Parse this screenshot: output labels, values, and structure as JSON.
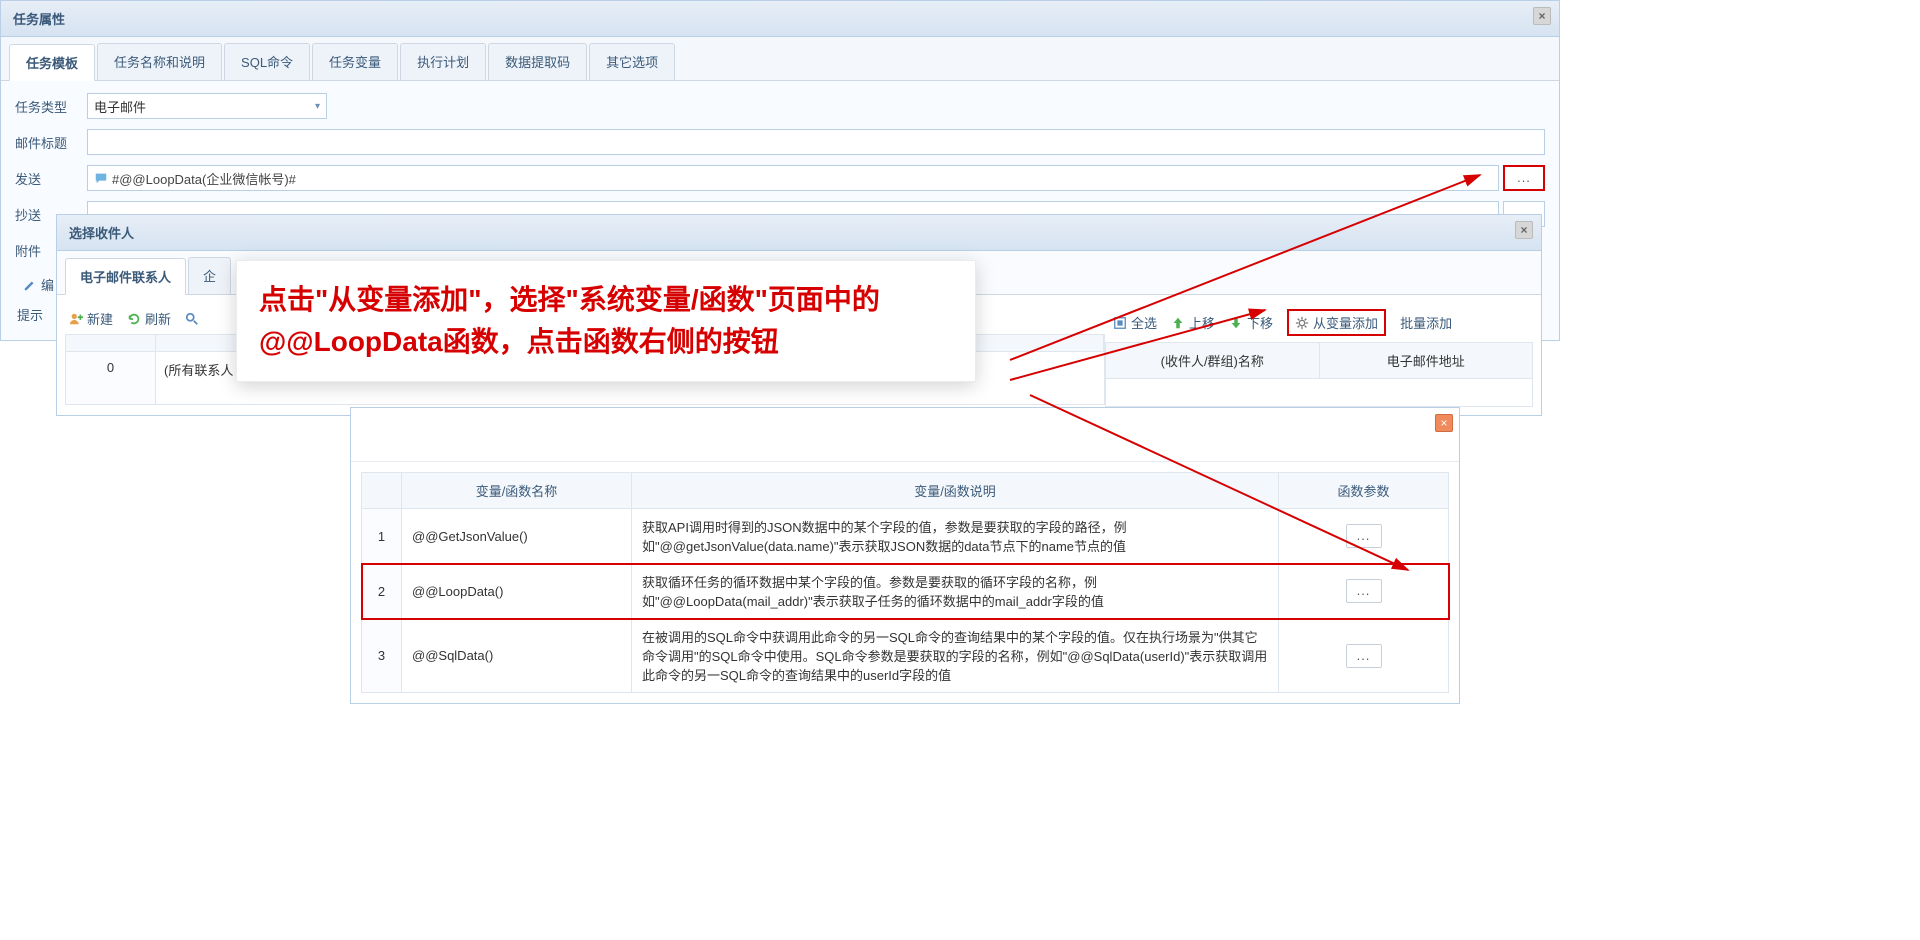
{
  "main_dialog": {
    "title": "任务属性",
    "tabs": [
      "任务模板",
      "任务名称和说明",
      "SQL命令",
      "任务变量",
      "执行计划",
      "数据提取码",
      "其它选项"
    ],
    "active_tab_index": 0,
    "form": {
      "task_type_label": "任务类型",
      "task_type_value": "电子邮件",
      "subject_label": "邮件标题",
      "subject_value": "",
      "send_label": "发送",
      "send_value": "#@@LoopData(企业微信帐号)#",
      "cc_label": "抄送",
      "attachment_label": "附件",
      "edit_label": "编",
      "tip_label": "提示"
    }
  },
  "picker_dialog": {
    "title": "选择收件人",
    "tabs": [
      "电子邮件联系人",
      "企"
    ],
    "active_tab_index": 0,
    "left_toolbar": {
      "new": "新建",
      "refresh": "刷新",
      "search": ""
    },
    "left_grid": {
      "idx": "0",
      "cell": "(所有联系人"
    },
    "right_toolbar": {
      "select_all": "全选",
      "move_up": "上移",
      "move_down": "下移",
      "from_var": "从变量添加",
      "batch_add": "批量添加"
    },
    "right_headers": {
      "name": "(收件人/群组)名称",
      "email": "电子邮件地址"
    }
  },
  "var_dialog": {
    "headers": {
      "name": "变量/函数名称",
      "desc": "变量/函数说明",
      "param": "函数参数"
    },
    "rows": [
      {
        "idx": "1",
        "name": "@@GetJsonValue()",
        "desc": "获取API调用时得到的JSON数据中的某个字段的值，参数是要获取的字段的路径，例如\"@@getJsonValue(data.name)\"表示获取JSON数据的data节点下的name节点的值",
        "param": "..."
      },
      {
        "idx": "2",
        "name": "@@LoopData()",
        "desc": "获取循环任务的循环数据中某个字段的值。参数是要获取的循环字段的名称，例如\"@@LoopData(mail_addr)\"表示获取子任务的循环数据中的mail_addr字段的值",
        "param": "..."
      },
      {
        "idx": "3",
        "name": "@@SqlData()",
        "desc": "在被调用的SQL命令中获调用此命令的另一SQL命令的查询结果中的某个字段的值。仅在执行场景为\"供其它命令调用\"的SQL命令中使用。SQL命令参数是要获取的字段的名称，例如\"@@SqlData(userId)\"表示获取调用此命令的另一SQL命令的查询结果中的userId字段的值",
        "param": "..."
      }
    ],
    "highlight_index": 1
  },
  "callout": {
    "text": "点击\"从变量添加\"，选择\"系统变量/函数\"页面中的@@LoopData函数，点击函数右侧的按钮"
  },
  "ellipsis": "..."
}
